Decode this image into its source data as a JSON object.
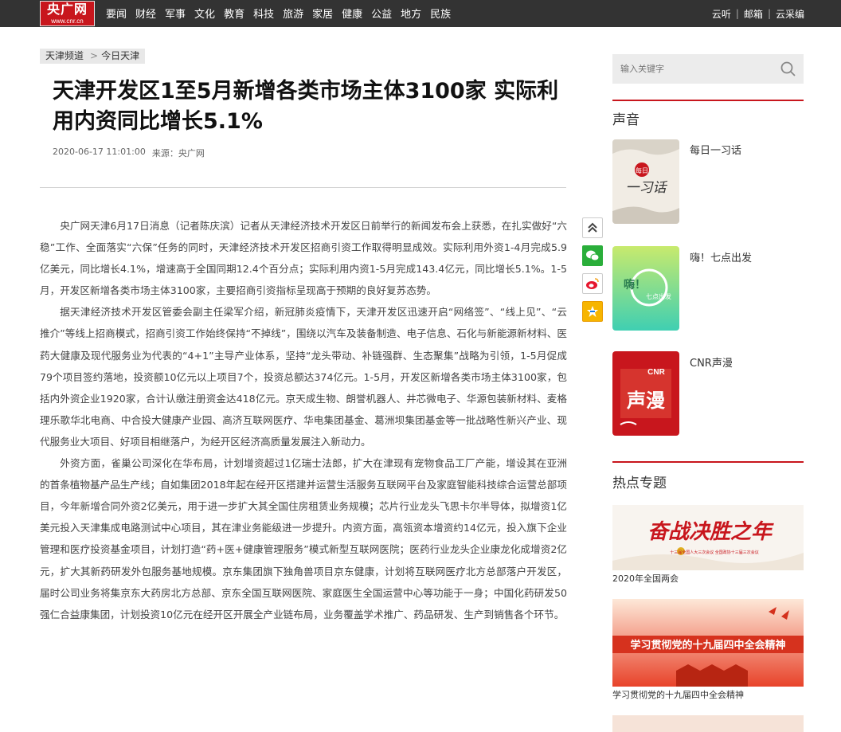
{
  "header": {
    "logo_main": "央广网",
    "logo_sub": "www.cnr.cn",
    "nav": [
      "要闻",
      "财经",
      "军事",
      "文化",
      "教育",
      "科技",
      "旅游",
      "家居",
      "健康",
      "公益",
      "地方",
      "民族"
    ],
    "links": [
      "云听",
      "邮箱",
      "云采编"
    ],
    "separator": "|"
  },
  "breadcrumb": {
    "channel": "天津频道",
    "gt": ">",
    "section": "今日天津"
  },
  "article": {
    "title": "天津开发区1至5月新增各类市场主体3100家 实际利用内资同比增长5.1%",
    "datetime": "2020-06-17 11:01:00",
    "source": "来源：央广网",
    "paragraphs": [
      "央广网天津6月17日消息（记者陈庆滨）记者从天津经济技术开发区日前举行的新闻发布会上获悉，在扎实做好“六稳”工作、全面落实“六保”任务的同时，天津经济技术开发区招商引资工作取得明显成效。实际利用外资1-4月完成5.9亿美元，同比增长4.1%，增速高于全国同期12.4个百分点；实际利用内资1-5月完成143.4亿元，同比增长5.1%。1-5月，开发区新增各类市场主体3100家，主要招商引资指标呈现高于预期的良好复苏态势。",
      "据天津经济技术开发区管委会副主任梁军介绍，新冠肺炎疫情下，天津开发区迅速开启“网络签”、“线上见”、“云推介”等线上招商模式，招商引资工作始终保持“不掉线”，围绕以汽车及装备制造、电子信息、石化与新能源新材料、医药大健康及现代服务业为代表的“4+1”主导产业体系，坚持“龙头带动、补链强群、生态聚集”战略为引领，1-5月促成79个项目签约落地，投资额10亿元以上项目7个，投资总额达374亿元。1-5月，开发区新增各类市场主体3100家，包括内外资企业1920家，合计认缴注册资金达418亿元。京天成生物、朗誉机器人、井芯微电子、华源包装新材料、麦格理乐歌华北电商、中合投大健康产业园、高济互联网医疗、华电集团基金、葛洲坝集团基金等一批战略性新兴产业、现代服务业大项目、好项目相继落户，为经开区经济高质量发展注入新动力。",
      "外资方面，雀巢公司深化在华布局，计划增资超过1亿瑞士法郎，扩大在津现有宠物食品工厂产能，增设其在亚洲的首条植物基产品生产线；自如集团2018年起在经开区搭建并运营生活服务互联网平台及家庭智能科技综合运营总部项目，今年新增合同外资2亿美元，用于进一步扩大其全国住房租赁业务规模；芯片行业龙头飞思卡尔半导体，拟增资1亿美元投入天津集成电路测试中心项目，其在津业务能级进一步提升。内资方面，高瓴资本增资约14亿元，投入旗下企业管理和医疗投资基金项目，计划打造“药+医+健康管理服务”模式新型互联网医院；医药行业龙头企业康龙化成增资2亿元，扩大其新药研发外包服务基地规模。京东集团旗下独角兽项目京东健康，计划将互联网医疗北方总部落户开发区，届时公司业务将集京东大药房北方总部、京东全国互联网医院、家庭医生全国运营中心等功能于一身；中国化药研发50强仁合益康集团，计划投资10亿元在经开区开展全产业链布局，业务覆盖学术推广、药品研发、生产到销售各个环节。"
    ]
  },
  "share_icons": [
    "back-to-top-icon",
    "wechat-icon",
    "weibo-icon",
    "qzone-icon"
  ],
  "sidebar": {
    "search_placeholder": "输入关键字",
    "voice_title": "声音",
    "voice_items": [
      {
        "label": "每日一习话",
        "img_text": "一习话",
        "img_small": "每日"
      },
      {
        "label": "嗨！七点出发",
        "img_text": "嗨！",
        "img_small": "七点出发"
      },
      {
        "label": "CNR声漫",
        "img_text": "声漫",
        "img_small": "CNR"
      }
    ],
    "topics_title": "热点专题",
    "topics": [
      {
        "caption": "2020年全国两会",
        "banner": "奋战决胜之年",
        "banner_sub": "十三届全国人大三次会议 全国政协十三届三次会议"
      },
      {
        "caption": "学习贯彻党的十九届四中全会精神",
        "banner": "学习贯彻党的十九届四中全会精神"
      }
    ]
  },
  "colors": {
    "brand_red": "#c8161d",
    "topbar": "#333333"
  }
}
